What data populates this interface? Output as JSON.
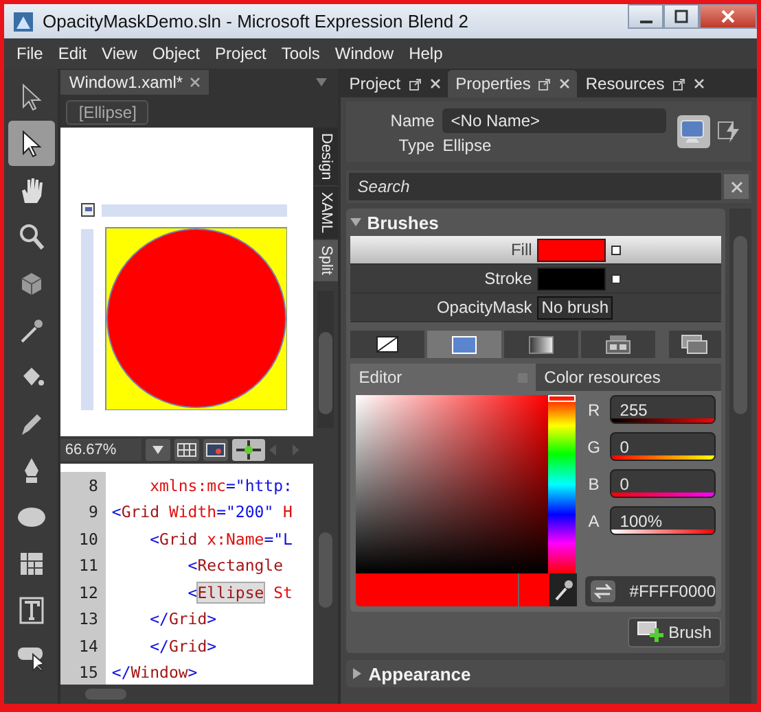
{
  "window": {
    "title": "OpacityMaskDemo.sln - Microsoft Expression Blend 2"
  },
  "menu": [
    "File",
    "Edit",
    "View",
    "Object",
    "Project",
    "Tools",
    "Window",
    "Help"
  ],
  "tools": [
    {
      "kind": "arrow",
      "selected": false
    },
    {
      "kind": "arrow",
      "selected": true
    },
    {
      "kind": "hand",
      "selected": false
    },
    {
      "kind": "zoom",
      "selected": false
    },
    {
      "kind": "cube",
      "selected": false
    },
    {
      "kind": "dropper",
      "selected": false
    },
    {
      "kind": "bucket",
      "selected": false
    },
    {
      "kind": "pencil",
      "selected": false
    },
    {
      "kind": "pen",
      "selected": false
    },
    {
      "kind": "ellipse",
      "selected": false
    },
    {
      "kind": "grid",
      "selected": false
    },
    {
      "kind": "text",
      "selected": false
    },
    {
      "kind": "balloon",
      "selected": false
    }
  ],
  "document": {
    "tab": "Window1.xaml*",
    "breadcrumb": "[Ellipse]",
    "zoom": "66.67%",
    "view_tabs": [
      {
        "label": "Design",
        "selected": false
      },
      {
        "label": "XAML",
        "selected": false
      },
      {
        "label": "Split",
        "selected": true
      }
    ],
    "code": [
      {
        "number": "8",
        "tokens": [
          {
            "kind": "attr",
            "text": "    xmlns:mc"
          },
          {
            "kind": "value",
            "text": "=\"http:"
          }
        ]
      },
      {
        "number": "9",
        "tokens": [
          {
            "kind": "punct",
            "text": "<"
          },
          {
            "kind": "tag",
            "text": "Grid"
          },
          {
            "kind": "attr",
            "text": " Width"
          },
          {
            "kind": "value",
            "text": "=\"200\""
          },
          {
            "kind": "attr",
            "text": " H"
          }
        ]
      },
      {
        "number": "10",
        "tokens": [
          {
            "kind": "punct",
            "text": "    <"
          },
          {
            "kind": "tag",
            "text": "Grid"
          },
          {
            "kind": "attr",
            "text": " x:Name"
          },
          {
            "kind": "value",
            "text": "=\"L"
          }
        ]
      },
      {
        "number": "11",
        "tokens": [
          {
            "kind": "punct",
            "text": "        <"
          },
          {
            "kind": "tag",
            "text": "Rectangle"
          }
        ]
      },
      {
        "number": "12",
        "tokens": [
          {
            "kind": "punct",
            "text": "        <"
          },
          {
            "kind": "match",
            "text": "Ellipse"
          },
          {
            "kind": "attr",
            "text": " St"
          }
        ]
      },
      {
        "number": "13",
        "tokens": [
          {
            "kind": "punct",
            "text": "    </"
          },
          {
            "kind": "tag",
            "text": "Grid"
          },
          {
            "kind": "punct",
            "text": ">"
          }
        ]
      },
      {
        "number": "14",
        "tokens": [
          {
            "kind": "punct",
            "text": "    </"
          },
          {
            "kind": "tag",
            "text": "Grid"
          },
          {
            "kind": "punct",
            "text": ">"
          }
        ]
      },
      {
        "number": "15",
        "tokens": [
          {
            "kind": "punct",
            "text": "</"
          },
          {
            "kind": "tag",
            "text": "Window"
          },
          {
            "kind": "punct",
            "text": ">"
          }
        ]
      }
    ]
  },
  "panel_tabs": [
    {
      "label": "Project",
      "selected": false
    },
    {
      "label": "Properties",
      "selected": true
    },
    {
      "label": "Resources",
      "selected": false
    }
  ],
  "properties": {
    "name_label": "Name",
    "name": "<No Name>",
    "type_label": "Type",
    "type": "Ellipse",
    "search": {
      "placeholder": "Search"
    }
  },
  "brushes": {
    "title": "Brushes",
    "expanded": true,
    "rows": [
      {
        "label": "Fill",
        "selected": true,
        "color": "#ff0000"
      },
      {
        "label": "Stroke",
        "selected": false,
        "color": "#000000"
      },
      {
        "label": "OpacityMask",
        "selected": false,
        "value": "No brush"
      }
    ],
    "types": [
      {
        "kind": "none",
        "selected": false
      },
      {
        "kind": "solid",
        "selected": true
      },
      {
        "kind": "gradient",
        "selected": false
      },
      {
        "kind": "tile",
        "selected": false
      },
      {
        "kind": "resource",
        "selected": false
      }
    ],
    "editor_tabs": [
      {
        "label": "Editor",
        "selected": true
      },
      {
        "label": "Color resources",
        "selected": false
      }
    ],
    "channels": [
      {
        "label": "R",
        "value": "255",
        "kind": "red"
      },
      {
        "label": "G",
        "value": "0",
        "kind": "green"
      },
      {
        "label": "B",
        "value": "0",
        "kind": "blue"
      },
      {
        "label": "A",
        "value": "100%",
        "kind": "alpha"
      }
    ],
    "hue": {
      "level": 0
    },
    "hex": "#FFFF0000",
    "brush_button": "Brush"
  },
  "appearance": {
    "title": "Appearance",
    "expanded": false
  }
}
